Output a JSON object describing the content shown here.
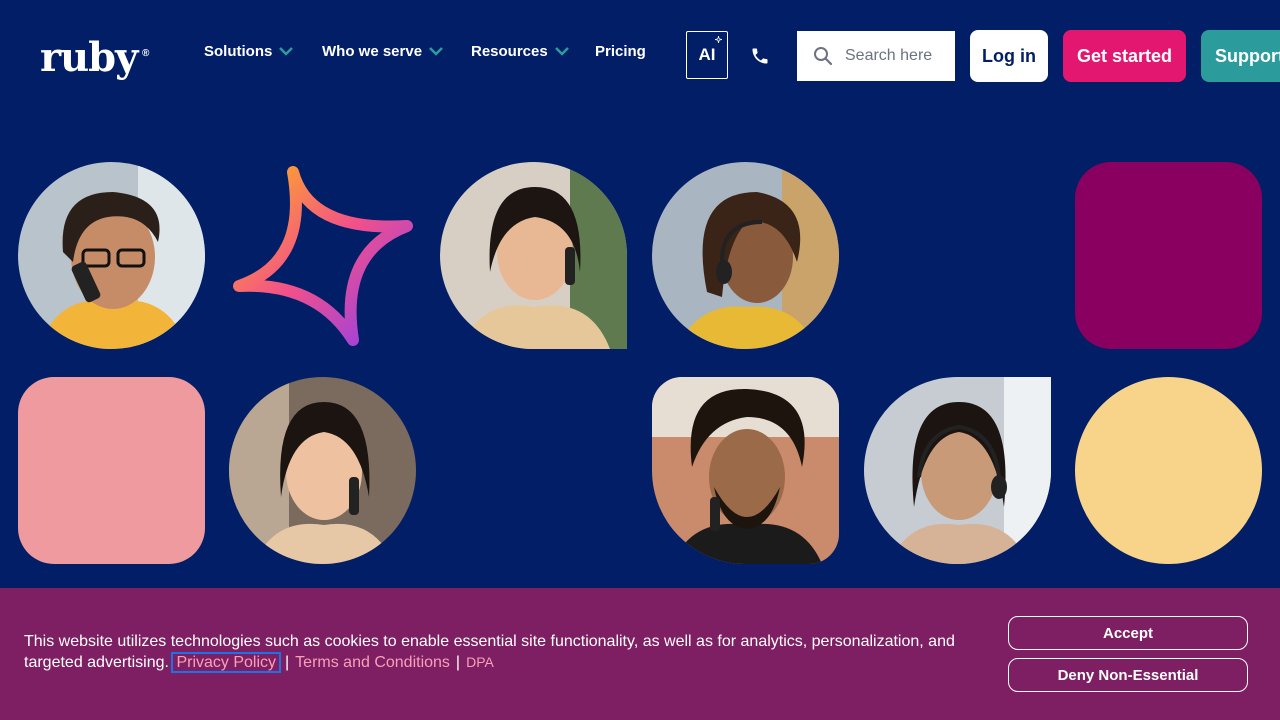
{
  "header": {
    "logo": "ruby",
    "logo_mark": "®",
    "nav": [
      {
        "label": "Solutions",
        "icon": "chevron-down-icon"
      },
      {
        "label": "Who we serve",
        "icon": "chevron-down-icon"
      },
      {
        "label": "Resources",
        "icon": "chevron-down-icon"
      },
      {
        "label": "Pricing"
      }
    ],
    "ai_label": "AI",
    "search_placeholder": "Search here",
    "login_label": "Log in",
    "get_started_label": "Get started",
    "support_label": "Support"
  },
  "colors": {
    "background": "#021e66",
    "accent_pink": "#e3176f",
    "accent_teal": "#2c9b9b",
    "cookie_bg": "#7d1f62",
    "tile_magenta": "#8a0060",
    "tile_pink": "#ee9a9e",
    "tile_yellow": "#f8d48a"
  },
  "cookie": {
    "text": "This website utilizes technologies such as cookies to enable essential site functionality, as well as for analytics, personalization, and targeted advertising.",
    "privacy_link": "Privacy Policy",
    "separator": "|",
    "terms_link": "Terms and Conditions",
    "dpa_link": "DPA",
    "accept_label": "Accept",
    "deny_label": "Deny Non-Essential"
  }
}
